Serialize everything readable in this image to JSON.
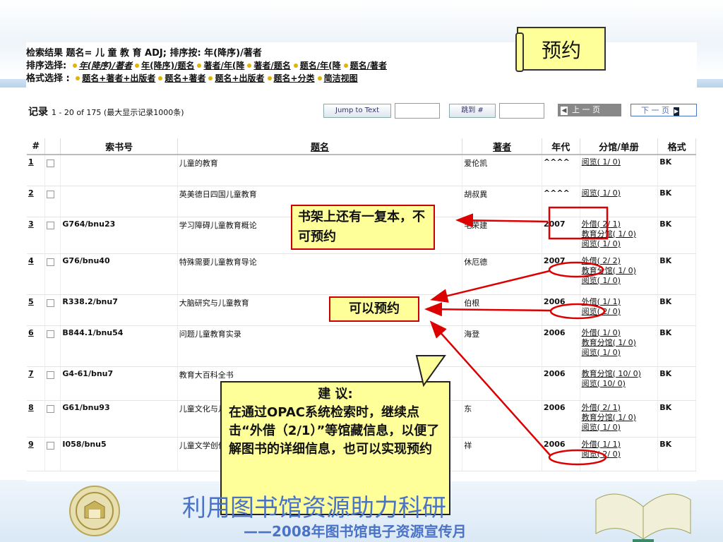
{
  "query": {
    "line1": "检索结果 题名= 儿 童 教 育 ADJ; 排序按: 年(降序)/著者",
    "line2_label": "排序选择:",
    "line2_options": [
      "年(降序)/著者",
      "年(降序)/题名",
      "著者/年(降",
      "著者/题名",
      "题名/年(降",
      "题名/著者"
    ],
    "line3_label": "格式选择 :",
    "line3_options": [
      "题名+著者+出版者",
      "题名+著者",
      "题名+出版者",
      "题名+分类",
      "简洁视图"
    ]
  },
  "reserve_note": "预约",
  "records": {
    "label": "记录",
    "range": "1 - 20 of 175 (最大显示记录1000条)",
    "jump_text_button": "Jump to Text",
    "jump_num_button": "跳到 #",
    "prev_page": "上 一 页",
    "next_page": "下 一 页"
  },
  "table": {
    "headers": [
      "#",
      "",
      "索书号",
      "题名",
      "著者",
      "年代",
      "分馆/单册",
      "格式"
    ],
    "rows": [
      {
        "n": "1",
        "call": "",
        "title": "儿童的教育",
        "author": "爱伦凯",
        "year": "^^^^",
        "holdings": [
          "阅览( 1/ 0)"
        ],
        "fmt": "BK"
      },
      {
        "n": "2",
        "call": "",
        "title": "英美德日四国儿童教育",
        "author": "胡叔異",
        "year": "^^^^",
        "holdings": [
          "阅览( 1/ 0)"
        ],
        "fmt": "BK"
      },
      {
        "n": "3",
        "call": "G764/bnu23",
        "title": "学习障碍儿童教育概论",
        "author": "毛荣建",
        "year": "2007",
        "holdings": [
          "外借( 2/ 1)",
          "教育分馆( 1/ 0)",
          "阅览( 1/ 0)"
        ],
        "fmt": "BK"
      },
      {
        "n": "4",
        "call": "G76/bnu40",
        "title": "特殊需要儿童教育导论",
        "author": "休厄德",
        "year": "2007",
        "holdings": [
          "外借( 2/ 2)",
          "教育分馆( 1/ 0)",
          "阅览( 1/ 0)"
        ],
        "fmt": "BK"
      },
      {
        "n": "5",
        "call": "R338.2/bnu7",
        "title": "大脑研究与儿童教育",
        "author": "伯根",
        "year": "2006",
        "holdings": [
          "外借( 1/ 1)",
          "阅览( 2/ 0)"
        ],
        "fmt": "BK"
      },
      {
        "n": "6",
        "call": "B844.1/bnu54",
        "title": "问题儿童教育实录",
        "author": "海登",
        "year": "2006",
        "holdings": [
          "外借( 1/ 0)",
          "教育分馆( 1/ 0)",
          "阅览( 1/ 0)"
        ],
        "fmt": "BK"
      },
      {
        "n": "7",
        "call": "G4-61/bnu7",
        "title": "教育大百科全书",
        "author": "",
        "year": "2006",
        "holdings": [
          "教育分馆( 10/ 0)",
          "阅览( 10/ 0)"
        ],
        "fmt": "BK"
      },
      {
        "n": "8",
        "call": "G61/bnu93",
        "title": "儿童文化与儿",
        "author": "东",
        "year": "2006",
        "holdings": [
          "外借( 2/ 1)",
          "教育分馆( 1/ 0)",
          "阅览( 1/ 0)"
        ],
        "fmt": "BK"
      },
      {
        "n": "9",
        "call": "I058/bnu5",
        "title": "儿童文学创作",
        "author": "祥",
        "year": "2006",
        "holdings": [
          "外借( 1/ 1)",
          "阅览( 2/ 0)"
        ],
        "fmt": "BK"
      }
    ]
  },
  "callouts": {
    "copy_on_shelf": "书架上还有一复本，不可预约",
    "can_reserve": "可以预约",
    "advice_title": "建 议:",
    "advice_body": "在通过OPAC系统检索时，继续点击“外借（2/1）”等馆藏信息，以便了解图书的详细信息，也可以实现预约"
  },
  "footer": {
    "title": "利用图书馆资源助力科研",
    "subtitle": "——2008年图书馆电子资源宣传月"
  }
}
